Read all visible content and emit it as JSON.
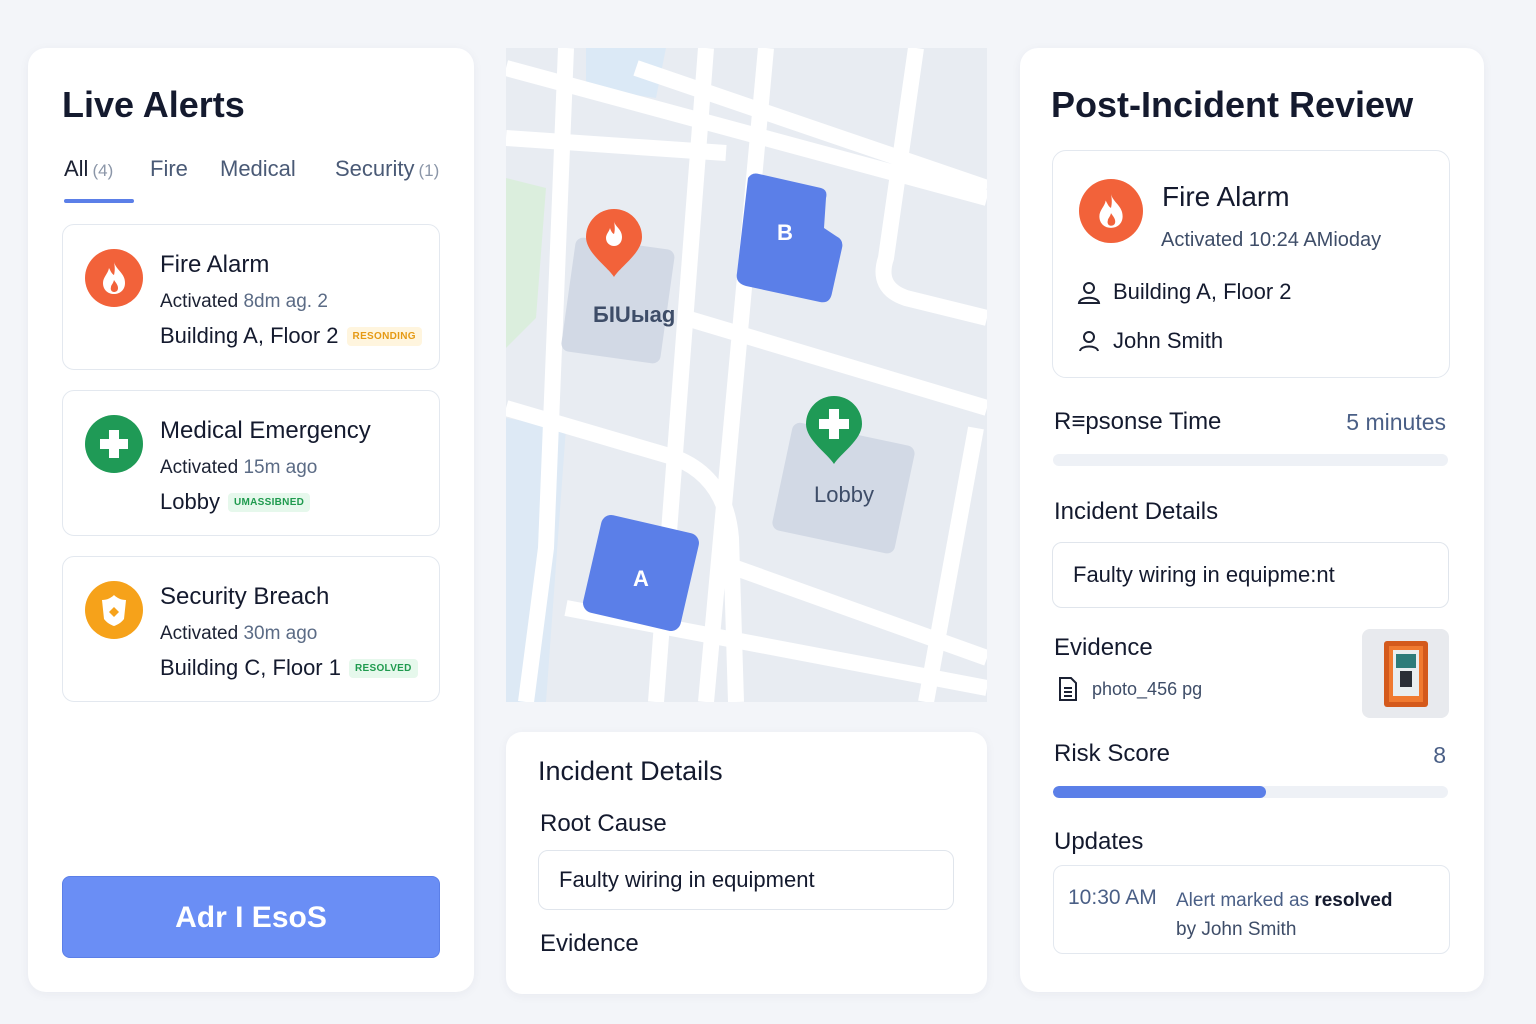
{
  "live_alerts": {
    "title": "Live Alerts",
    "tabs": [
      {
        "label": "All",
        "count": "(4)"
      },
      {
        "label": "Fire",
        "count": ""
      },
      {
        "label": "Medical",
        "count": ""
      },
      {
        "label": "Security",
        "count": "(1)"
      }
    ],
    "alerts": [
      {
        "title": "Fire Alarm",
        "activated": "Activated",
        "ago": "8dm ag. 2",
        "location": "Building A, Floor 2",
        "status": "RESONDING",
        "icon": "flame-icon",
        "color": "#f2623a"
      },
      {
        "title": "Medical Emergency",
        "activated": "Activated",
        "ago": "15m ago",
        "location": "Lobby",
        "status": "UMASSIBNED",
        "icon": "medical-cross-icon",
        "color": "#1f9a56"
      },
      {
        "title": "Security Breach",
        "activated": "Activated",
        "ago": "30m ago",
        "location": "Building C, Floor 1",
        "status": "RESOLVED",
        "icon": "shield-icon",
        "color": "#f6a21a"
      }
    ],
    "button_label": "Adr I EsoS"
  },
  "map": {
    "labels": {
      "building_fire": "БIUыag",
      "b": "B",
      "lobby": "Lobby",
      "a": "A"
    }
  },
  "incident_details": {
    "title": "Incident Details",
    "root_cause_label": "Root Cause",
    "root_cause_value": "Faulty wiring in equipment",
    "evidence_label": "Evidence"
  },
  "review": {
    "title": "Post-Incident Review",
    "alert_title": "Fire Alarm",
    "activated": "Activated 10:24 AMioday",
    "location": "Building A, Floor 2",
    "person": "John Smith",
    "response_time_label": "R≡psonse Time",
    "response_time_value": "5 minutes",
    "details_label": "Incident Details",
    "details_value": "Faulty wiring in equipme:nt",
    "evidence_label": "Evidence",
    "evidence_file": "photo_456 pg",
    "risk_label": "Risk Score",
    "risk_value": "8",
    "risk_fraction": 0.54,
    "updates_label": "Updates",
    "update_time": "10:30 AM",
    "update_text": "Alert marked as",
    "update_status": "resolved",
    "update_by": "by John Smith"
  },
  "colors": {
    "accent": "#5b7fe8",
    "fire": "#f2623a",
    "medical": "#1f9a56",
    "security": "#f6a21a",
    "map_building": "#5b7fe8"
  }
}
